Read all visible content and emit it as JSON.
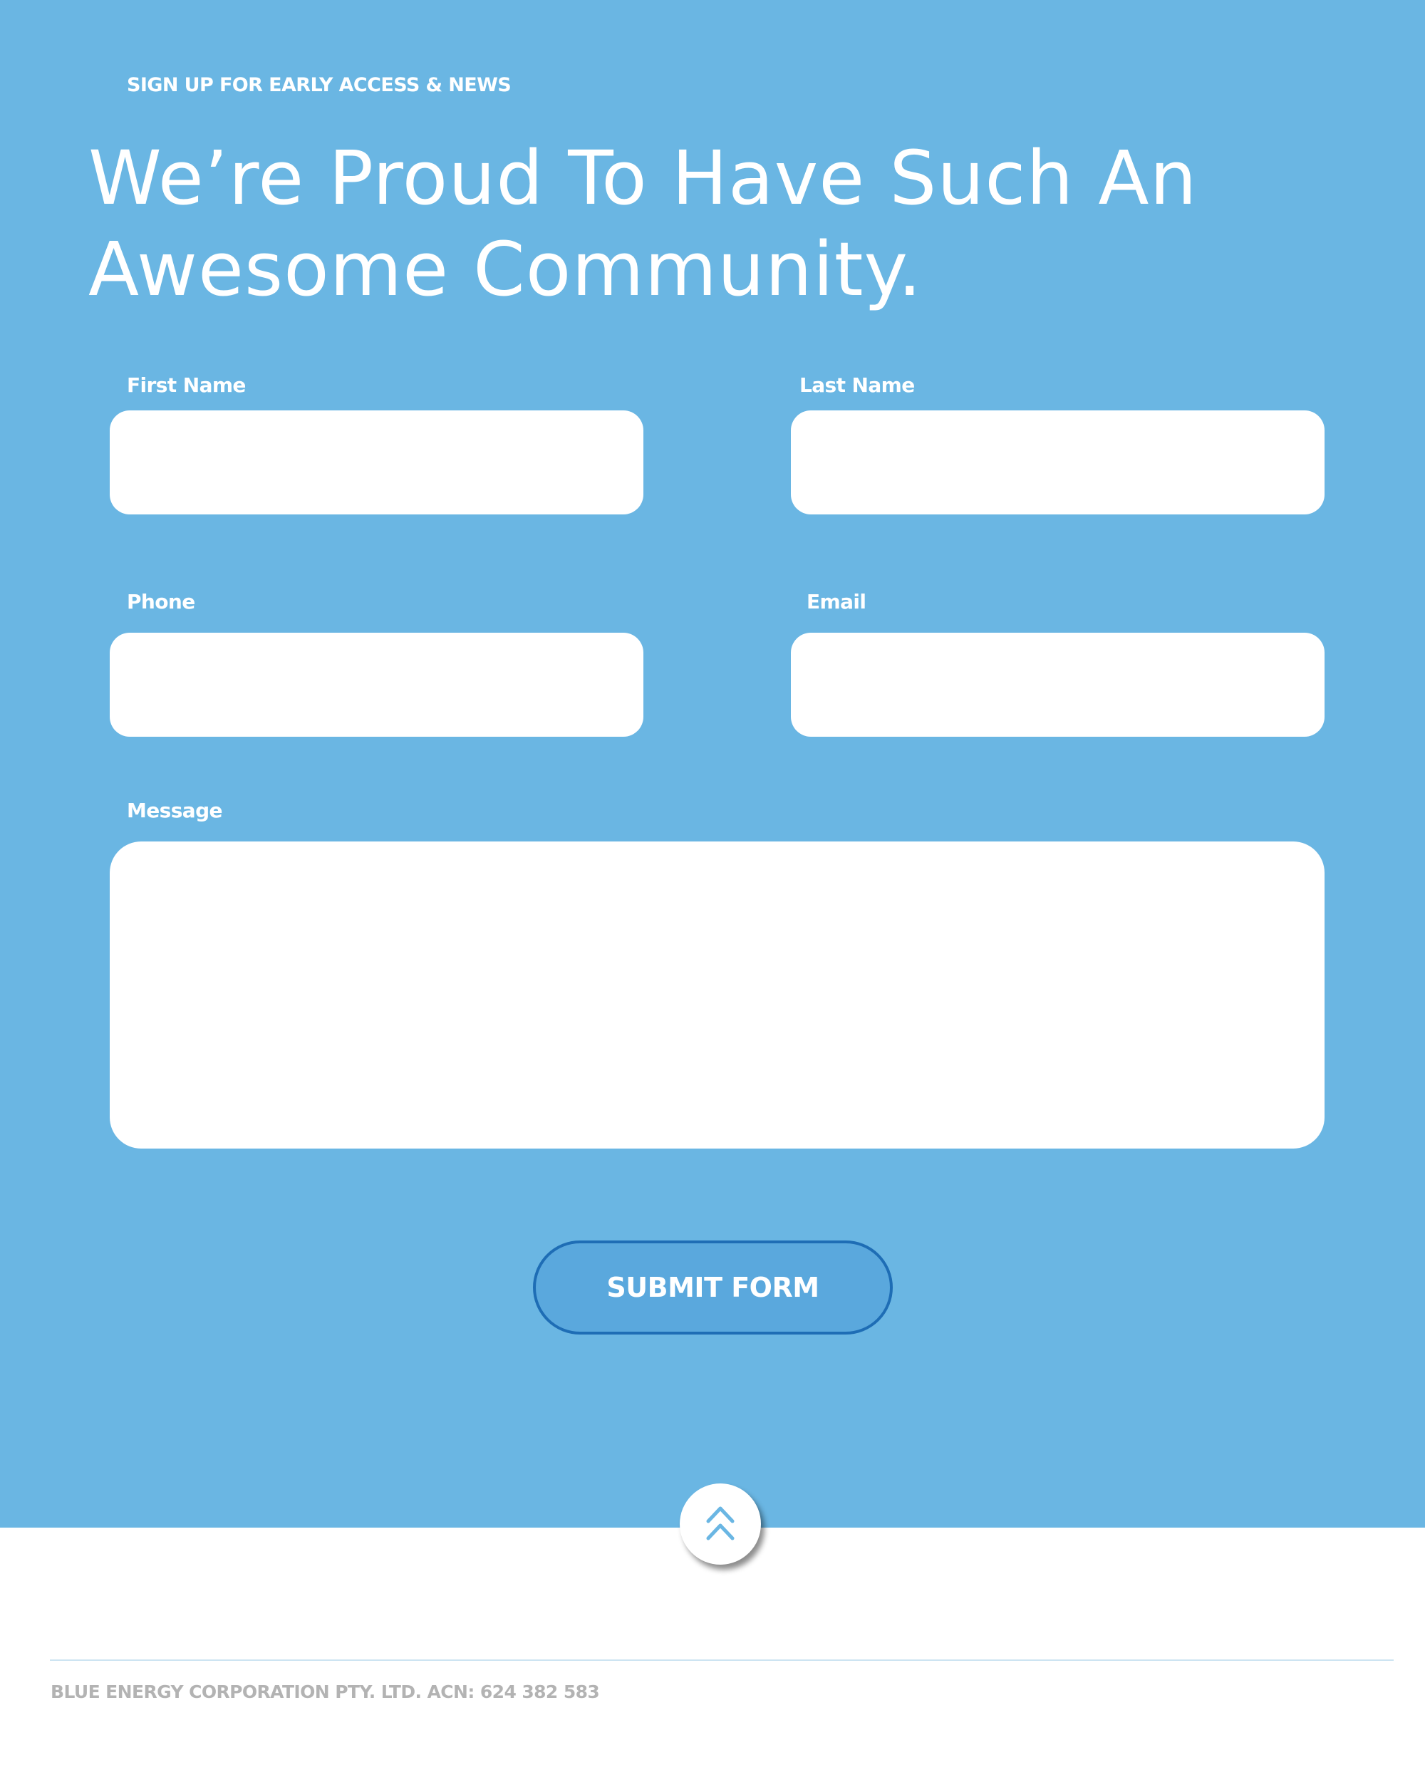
{
  "colors": {
    "hero_background": "#6ab6e3",
    "button_background": "#5aa8dd",
    "button_border": "#1e6db5",
    "icon_color": "#6ab6e3",
    "footer_text": "#b3b3b3"
  },
  "hero": {
    "eyebrow": "SIGN UP FOR EARLY ACCESS & NEWS",
    "headline": "We’re Proud To Have Such An Awesome Community."
  },
  "form": {
    "first_name": {
      "label": "First Name",
      "value": "",
      "placeholder": ""
    },
    "last_name": {
      "label": "Last Name",
      "value": "",
      "placeholder": ""
    },
    "phone": {
      "label": "Phone",
      "value": "",
      "placeholder": ""
    },
    "email": {
      "label": "Email",
      "value": "",
      "placeholder": ""
    },
    "message": {
      "label": "Message",
      "value": "",
      "placeholder": ""
    },
    "submit_label": "SUBMIT FORM"
  },
  "scroll_top": {
    "icon": "double-chevron-up-icon"
  },
  "footer": {
    "company": "BLUE ENERGY CORPORATION PTY. LTD. ACN: 624 382 583"
  }
}
